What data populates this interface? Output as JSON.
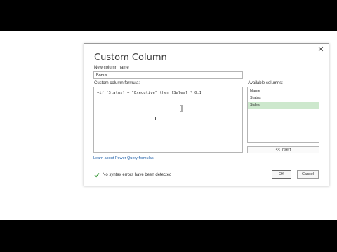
{
  "dialog": {
    "title": "Custom Column",
    "close_glyph": "✕",
    "new_column_name_label": "New column name",
    "new_column_name_value": "Bonus",
    "formula_label": "Custom column formula:",
    "formula_value": "=if [Status] = \"Executive\" then [Sales] * 0.1",
    "available_columns_label": "Available columns:",
    "available_columns": [
      {
        "label": "Name",
        "selected": false
      },
      {
        "label": "Status",
        "selected": false
      },
      {
        "label": "Sales",
        "selected": true
      }
    ],
    "insert_label": "<< Insert",
    "learn_link": "Learn about Power Query formulas",
    "status_message": "No syntax errors have been detected",
    "ok_label": "OK",
    "cancel_label": "Cancel"
  },
  "colors": {
    "selected_row": "#cde8cd",
    "status_check": "#3a9a3a",
    "link": "#1e5fa8"
  }
}
